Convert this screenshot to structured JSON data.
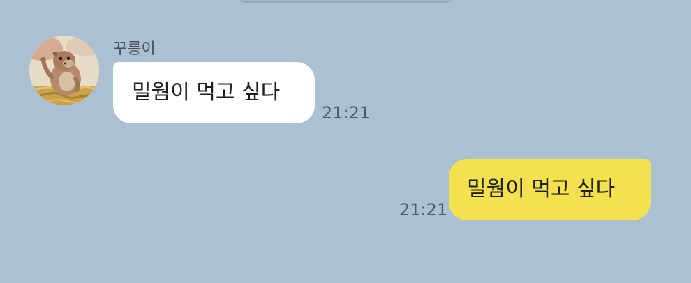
{
  "chat": {
    "messages": [
      {
        "direction": "incoming",
        "sender": "꾸릉이",
        "text": "밀웜이 먹고 싶다",
        "time": "21:21",
        "avatar_icon": "prairie-dog-photo"
      },
      {
        "direction": "outgoing",
        "text": "밀웜이 먹고 싶다",
        "time": "21:21"
      }
    ]
  },
  "colors": {
    "background": "#abc1d1",
    "incoming_bubble": "#ffffff",
    "outgoing_bubble": "#f5e04e"
  }
}
